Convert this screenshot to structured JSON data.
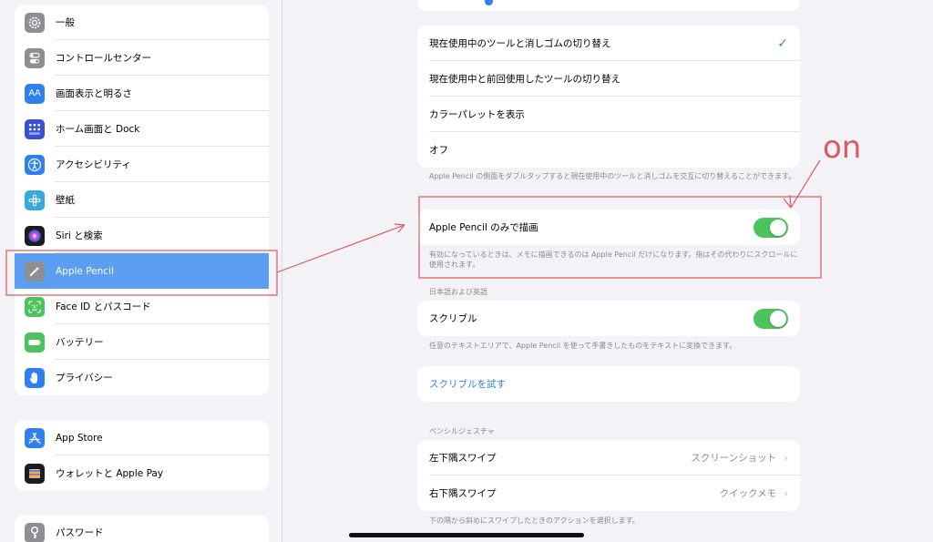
{
  "sidebar": {
    "group1": [
      {
        "label": "一般",
        "icon": "gear-icon",
        "color": "#8e8e93"
      },
      {
        "label": "コントロールセンター",
        "icon": "toggles-icon",
        "color": "#8e8e93"
      },
      {
        "label": "画面表示と明るさ",
        "icon": "text-size-icon",
        "color": "#2f7ff0"
      },
      {
        "label": "ホーム画面と Dock",
        "icon": "grid-icon",
        "color": "#3a4fd8"
      },
      {
        "label": "アクセシビリティ",
        "icon": "accessibility-icon",
        "color": "#2f7ff0"
      },
      {
        "label": "壁紙",
        "icon": "wallpaper-icon",
        "color": "#36aadc"
      },
      {
        "label": "Siri と検索",
        "icon": "siri-icon",
        "color": "#222"
      },
      {
        "label": "Apple Pencil",
        "icon": "pencil-icon",
        "color": "#8e8e93"
      },
      {
        "label": "Face ID とパスコード",
        "icon": "faceid-icon",
        "color": "#4cc35c"
      },
      {
        "label": "バッテリー",
        "icon": "battery-icon",
        "color": "#4cc35c"
      },
      {
        "label": "プライバシー",
        "icon": "hand-icon",
        "color": "#2f7ff0"
      }
    ],
    "group2": [
      {
        "label": "App Store",
        "icon": "appstore-icon",
        "color": "#2f7ff0"
      },
      {
        "label": "ウォレットと Apple Pay",
        "icon": "wallet-icon",
        "color": "#222"
      }
    ],
    "group3": [
      {
        "label": "パスワード",
        "icon": "key-icon",
        "color": "#8e8e93"
      }
    ]
  },
  "double_tap": {
    "options": [
      "現在使用中のツールと消しゴムの切り替え",
      "現在使用中と前回使用したツールの切り替え",
      "カラーパレットを表示",
      "オフ"
    ],
    "check": "✓",
    "footer": "Apple Pencil の側面をダブルタップすると現在使用中のツールと消しゴムを交互に切り替えることができます。"
  },
  "pencil_only": {
    "label": "Apple Pencil のみで描画",
    "on": true,
    "footer": "有効になっているときは、メモに描画できるのは Apple Pencil だけになります。指はその代わりにスクロールに使用されます。"
  },
  "scribble_section": {
    "header": "日本語および英語",
    "label": "スクリブル",
    "on": true,
    "footer": "任意のテキストエリアで、Apple Pencil を使って手書きしたものをテキストに変換できます。",
    "try_label": "スクリブルを試す"
  },
  "gestures": {
    "header": "ペンシルジェスチャ",
    "rows": [
      {
        "label": "左下隅スワイプ",
        "value": "スクリーンショット"
      },
      {
        "label": "右下隅スワイプ",
        "value": "クイックメモ"
      }
    ],
    "footer": "下の隅から斜めにスワイプしたときのアクションを選択します。"
  },
  "annotation": {
    "text": "on",
    "color": "#e0575f"
  }
}
